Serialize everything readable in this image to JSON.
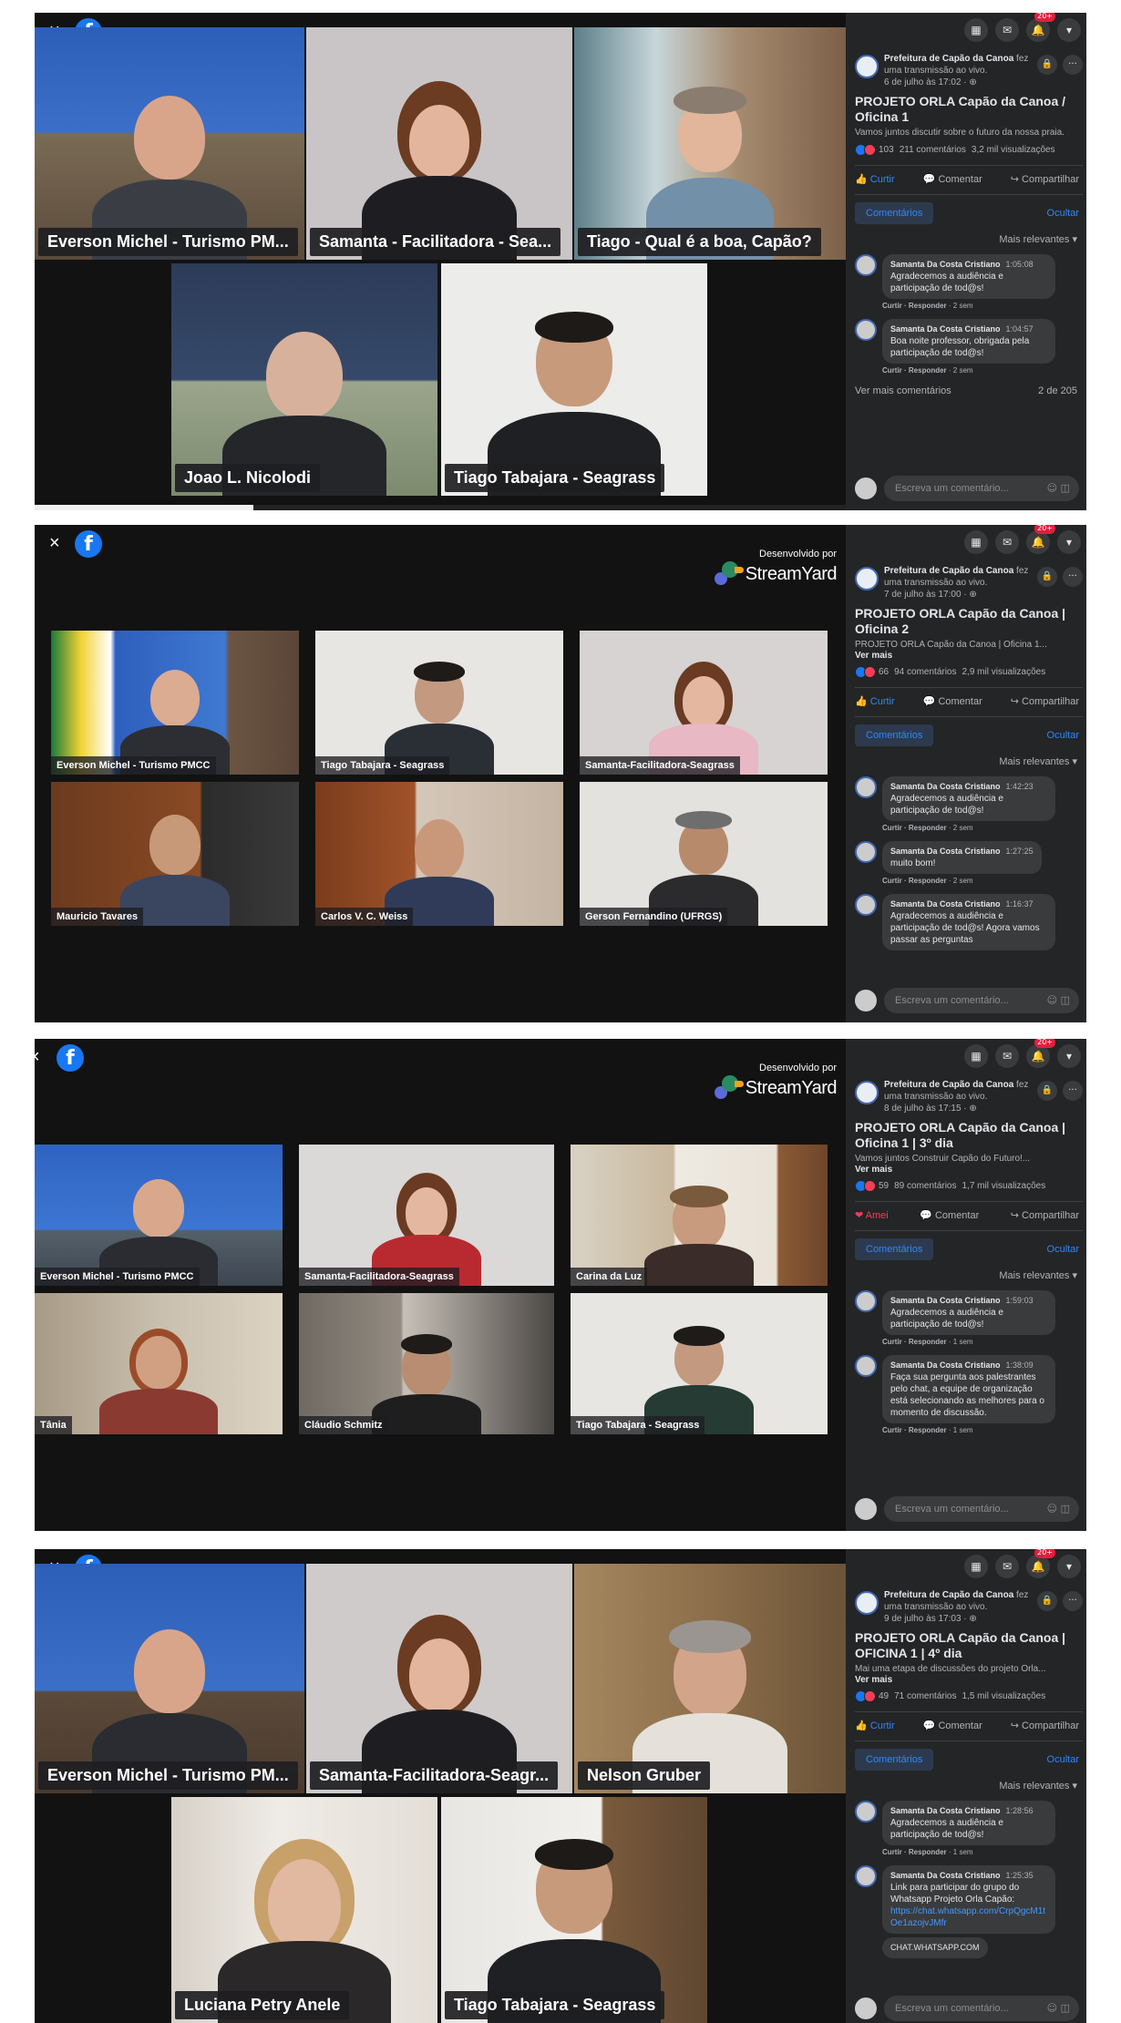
{
  "colors": {
    "facebook_blue": "#1877f2",
    "panel_bg": "#1b1b1b",
    "sidebar_bg": "#242526",
    "link": "#2d88ff"
  },
  "common": {
    "close_glyph": "×",
    "facebook_glyph": "f",
    "developed_by": "Desenvolvido por",
    "streamyard": "StreamYard",
    "badge": "20+",
    "menu_glyph": "▦",
    "messenger_glyph": "✉",
    "bell_glyph": "🔔",
    "caret_glyph": "▾",
    "lock_glyph": "🔒",
    "dots_glyph": "···",
    "comentar": "Comentar",
    "compartilhar": "Compartilhar",
    "comentarios_tab": "Comentários",
    "ocultar": "Ocultar",
    "mais_relevantes": "Mais relevantes ▾",
    "write_placeholder": "Escreva um comentário...",
    "emoji_glyph": "☺ ◫",
    "ver_mais": "Ver mais",
    "page_name": "Prefeitura de Capão da Canoa",
    "live_text": " fez uma transmissão ao vivo.",
    "comment_author": "Samanta Da Costa Cristiano",
    "comment_actions": "Curtir · Responder"
  },
  "panels": [
    {
      "participants": [
        "Everson Michel - Turismo PM...",
        "Samanta - Facilitadora - Sea...",
        "Tiago - Qual é a boa, Capão?",
        "Joao L. Nicolodi",
        "Tiago Tabajara - Seagrass"
      ],
      "progress": 0.27,
      "post": {
        "date": "6 de julho às 17:02 · ⊕",
        "title": "PROJETO ORLA Capão da Canoa / Oficina 1",
        "desc": "Vamos juntos discutir sobre o futuro da nossa praia.",
        "more": "",
        "reactions": "103",
        "comments": "211 comentários",
        "views": "3,2 mil visualizações",
        "like_label": "Curtir",
        "comments_list": [
          {
            "time": "1:05:08",
            "text": "Agradecemos a audiência e participação de tod@s!",
            "ago": "2 sem"
          },
          {
            "time": "1:04:57",
            "text": "Boa noite professor, obrigada pela participação de tod@s!",
            "ago": "2 sem"
          }
        ],
        "view_more_comments": "Ver mais comentários",
        "count_label": "2 de 205"
      }
    },
    {
      "participants": [
        "Everson Michel - Turismo PMCC",
        "Tiago Tabajara - Seagrass",
        "Samanta-Facilitadora-Seagrass",
        "Mauricio Tavares",
        "Carlos V. C. Weiss",
        "Gerson Fernandino (UFRGS)"
      ],
      "post": {
        "date": "7 de julho às 17:00 · ⊕",
        "title": "PROJETO ORLA Capão da Canoa | Oficina 2",
        "desc": "PROJETO ORLA Capão da Canoa | Oficina 1...",
        "more": "Ver mais",
        "reactions": "66",
        "comments": "94 comentários",
        "views": "2,9 mil visualizações",
        "like_label": "Curtir",
        "comments_list": [
          {
            "time": "1:42:23",
            "text": "Agradecemos a audiência e participação de tod@s!",
            "ago": "2 sem"
          },
          {
            "time": "1:27:25",
            "text": "muito bom!",
            "ago": "2 sem"
          },
          {
            "time": "1:16:37",
            "text": "Agradecemos a audiência e participação de tod@s! Agora vamos passar as perguntas",
            "ago": ""
          }
        ]
      }
    },
    {
      "participants": [
        "Everson Michel - Turismo PMCC",
        "Samanta-Facilitadora-Seagrass",
        "Carina da Luz",
        "Tânia",
        "Cláudio Schmitz",
        "Tiago Tabajara - Seagrass"
      ],
      "post": {
        "date": "8 de julho às 17:15 · ⊕",
        "title": "PROJETO ORLA Capão da Canoa | Oficina 1 | 3º dia",
        "desc": "Vamos juntos Construir Capão do Futuro!...",
        "more": "Ver mais",
        "reactions": "59",
        "comments": "89 comentários",
        "views": "1,7 mil visualizações",
        "like_label": "Amei",
        "comments_list": [
          {
            "time": "1:59:03",
            "text": "Agradecemos a audiência e participação de tod@s!",
            "ago": "1 sem"
          },
          {
            "time": "1:38:09",
            "text": "Faça sua pergunta aos palestrantes pelo chat, a equipe de organização está selecionando as melhores para o momento de discussão.",
            "ago": "1 sem"
          }
        ]
      }
    },
    {
      "participants": [
        "Everson Michel - Turismo PM...",
        "Samanta-Facilitadora-Seagr...",
        "Nelson Gruber",
        "Luciana Petry Anele",
        "Tiago Tabajara - Seagrass"
      ],
      "post": {
        "date": "9 de julho às 17:03 · ⊕",
        "title": "PROJETO ORLA Capão da Canoa | OFICINA 1 | 4º dia",
        "desc": "Mai uma etapa de discussões do projeto Orla...",
        "more": "Ver mais",
        "reactions": "49",
        "comments": "71 comentários",
        "views": "1,5 mil visualizações",
        "like_label": "Curtir",
        "comments_list": [
          {
            "time": "1:28:56",
            "text": "Agradecemos a audiência e participação de tod@s!",
            "ago": "1 sem"
          },
          {
            "time": "1:25:35",
            "text": "Link para participar do grupo do Whatsapp Projeto Orla Capão:",
            "link": "https://chat.whatsapp.com/CrpQgcM1tOe1azojvJMfr",
            "ago": ""
          }
        ],
        "preview": "CHAT.WHATSAPP.COM"
      }
    }
  ]
}
